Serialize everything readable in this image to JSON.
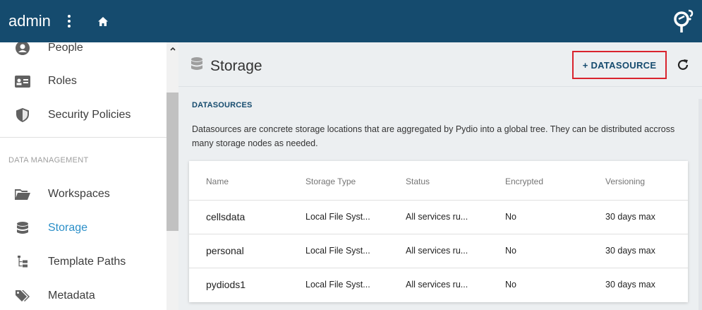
{
  "topbar": {
    "title": "admin",
    "menu_icon": "more-vert-icon",
    "home_icon": "home-icon",
    "logo_icon": "pydio-logo-icon"
  },
  "sidebar": {
    "items_top": [
      {
        "label": "People",
        "icon": "person-icon"
      },
      {
        "label": "Roles",
        "icon": "id-card-icon"
      },
      {
        "label": "Security Policies",
        "icon": "shield-icon"
      }
    ],
    "section_label": "DATA MANAGEMENT",
    "items_data": [
      {
        "label": "Workspaces",
        "icon": "folder-open-icon"
      },
      {
        "label": "Storage",
        "icon": "database-icon",
        "active": true
      },
      {
        "label": "Template Paths",
        "icon": "file-tree-icon"
      },
      {
        "label": "Metadata",
        "icon": "tags-icon"
      }
    ]
  },
  "main": {
    "title": "Storage",
    "add_button": "+ DATASOURCE",
    "section_title": "DATASOURCES",
    "description": "Datasources are concrete storage locations that are aggregated by Pydio into a global tree. They can be distributed accross many storage nodes as needed.",
    "table": {
      "headers": [
        "Name",
        "Storage Type",
        "Status",
        "Encrypted",
        "Versioning"
      ],
      "rows": [
        [
          "cellsdata",
          "Local File Syst...",
          "All services ru...",
          "No",
          "30 days max"
        ],
        [
          "personal",
          "Local File Syst...",
          "All services ru...",
          "No",
          "30 days max"
        ],
        [
          "pydiods1",
          "Local File Syst...",
          "All services ru...",
          "No",
          "30 days max"
        ]
      ]
    }
  },
  "colors": {
    "topbar": "#154b6e",
    "active": "#2b8fc8",
    "highlight_border": "#d9232d"
  }
}
